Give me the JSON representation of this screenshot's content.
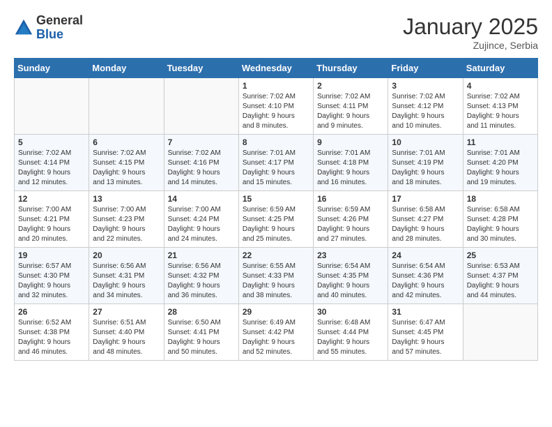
{
  "header": {
    "logo_general": "General",
    "logo_blue": "Blue",
    "month_title": "January 2025",
    "location": "Zujince, Serbia"
  },
  "days_of_week": [
    "Sunday",
    "Monday",
    "Tuesday",
    "Wednesday",
    "Thursday",
    "Friday",
    "Saturday"
  ],
  "weeks": [
    [
      {
        "day": "",
        "info": ""
      },
      {
        "day": "",
        "info": ""
      },
      {
        "day": "",
        "info": ""
      },
      {
        "day": "1",
        "info": "Sunrise: 7:02 AM\nSunset: 4:10 PM\nDaylight: 9 hours\nand 8 minutes."
      },
      {
        "day": "2",
        "info": "Sunrise: 7:02 AM\nSunset: 4:11 PM\nDaylight: 9 hours\nand 9 minutes."
      },
      {
        "day": "3",
        "info": "Sunrise: 7:02 AM\nSunset: 4:12 PM\nDaylight: 9 hours\nand 10 minutes."
      },
      {
        "day": "4",
        "info": "Sunrise: 7:02 AM\nSunset: 4:13 PM\nDaylight: 9 hours\nand 11 minutes."
      }
    ],
    [
      {
        "day": "5",
        "info": "Sunrise: 7:02 AM\nSunset: 4:14 PM\nDaylight: 9 hours\nand 12 minutes."
      },
      {
        "day": "6",
        "info": "Sunrise: 7:02 AM\nSunset: 4:15 PM\nDaylight: 9 hours\nand 13 minutes."
      },
      {
        "day": "7",
        "info": "Sunrise: 7:02 AM\nSunset: 4:16 PM\nDaylight: 9 hours\nand 14 minutes."
      },
      {
        "day": "8",
        "info": "Sunrise: 7:01 AM\nSunset: 4:17 PM\nDaylight: 9 hours\nand 15 minutes."
      },
      {
        "day": "9",
        "info": "Sunrise: 7:01 AM\nSunset: 4:18 PM\nDaylight: 9 hours\nand 16 minutes."
      },
      {
        "day": "10",
        "info": "Sunrise: 7:01 AM\nSunset: 4:19 PM\nDaylight: 9 hours\nand 18 minutes."
      },
      {
        "day": "11",
        "info": "Sunrise: 7:01 AM\nSunset: 4:20 PM\nDaylight: 9 hours\nand 19 minutes."
      }
    ],
    [
      {
        "day": "12",
        "info": "Sunrise: 7:00 AM\nSunset: 4:21 PM\nDaylight: 9 hours\nand 20 minutes."
      },
      {
        "day": "13",
        "info": "Sunrise: 7:00 AM\nSunset: 4:23 PM\nDaylight: 9 hours\nand 22 minutes."
      },
      {
        "day": "14",
        "info": "Sunrise: 7:00 AM\nSunset: 4:24 PM\nDaylight: 9 hours\nand 24 minutes."
      },
      {
        "day": "15",
        "info": "Sunrise: 6:59 AM\nSunset: 4:25 PM\nDaylight: 9 hours\nand 25 minutes."
      },
      {
        "day": "16",
        "info": "Sunrise: 6:59 AM\nSunset: 4:26 PM\nDaylight: 9 hours\nand 27 minutes."
      },
      {
        "day": "17",
        "info": "Sunrise: 6:58 AM\nSunset: 4:27 PM\nDaylight: 9 hours\nand 28 minutes."
      },
      {
        "day": "18",
        "info": "Sunrise: 6:58 AM\nSunset: 4:28 PM\nDaylight: 9 hours\nand 30 minutes."
      }
    ],
    [
      {
        "day": "19",
        "info": "Sunrise: 6:57 AM\nSunset: 4:30 PM\nDaylight: 9 hours\nand 32 minutes."
      },
      {
        "day": "20",
        "info": "Sunrise: 6:56 AM\nSunset: 4:31 PM\nDaylight: 9 hours\nand 34 minutes."
      },
      {
        "day": "21",
        "info": "Sunrise: 6:56 AM\nSunset: 4:32 PM\nDaylight: 9 hours\nand 36 minutes."
      },
      {
        "day": "22",
        "info": "Sunrise: 6:55 AM\nSunset: 4:33 PM\nDaylight: 9 hours\nand 38 minutes."
      },
      {
        "day": "23",
        "info": "Sunrise: 6:54 AM\nSunset: 4:35 PM\nDaylight: 9 hours\nand 40 minutes."
      },
      {
        "day": "24",
        "info": "Sunrise: 6:54 AM\nSunset: 4:36 PM\nDaylight: 9 hours\nand 42 minutes."
      },
      {
        "day": "25",
        "info": "Sunrise: 6:53 AM\nSunset: 4:37 PM\nDaylight: 9 hours\nand 44 minutes."
      }
    ],
    [
      {
        "day": "26",
        "info": "Sunrise: 6:52 AM\nSunset: 4:38 PM\nDaylight: 9 hours\nand 46 minutes."
      },
      {
        "day": "27",
        "info": "Sunrise: 6:51 AM\nSunset: 4:40 PM\nDaylight: 9 hours\nand 48 minutes."
      },
      {
        "day": "28",
        "info": "Sunrise: 6:50 AM\nSunset: 4:41 PM\nDaylight: 9 hours\nand 50 minutes."
      },
      {
        "day": "29",
        "info": "Sunrise: 6:49 AM\nSunset: 4:42 PM\nDaylight: 9 hours\nand 52 minutes."
      },
      {
        "day": "30",
        "info": "Sunrise: 6:48 AM\nSunset: 4:44 PM\nDaylight: 9 hours\nand 55 minutes."
      },
      {
        "day": "31",
        "info": "Sunrise: 6:47 AM\nSunset: 4:45 PM\nDaylight: 9 hours\nand 57 minutes."
      },
      {
        "day": "",
        "info": ""
      }
    ]
  ]
}
